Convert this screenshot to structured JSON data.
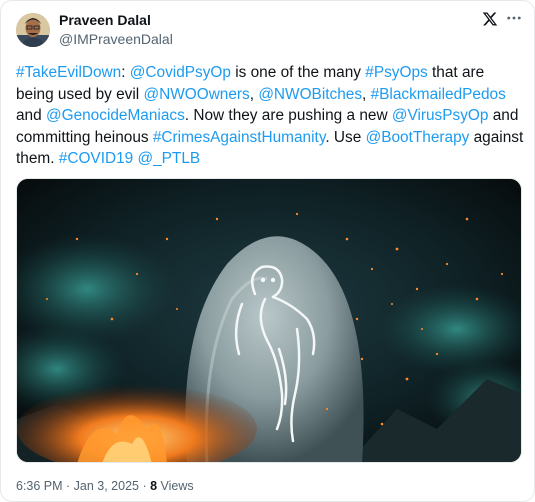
{
  "author": {
    "name": "Praveen Dalal",
    "handle": "@IMPraveenDalal"
  },
  "tweet": {
    "segments": [
      {
        "text": "#TakeEvilDown",
        "link": true
      },
      {
        "text": ": ",
        "link": false
      },
      {
        "text": "@CovidPsyOp",
        "link": true
      },
      {
        "text": " is one of the many ",
        "link": false
      },
      {
        "text": "#PsyOps",
        "link": true
      },
      {
        "text": " that are being used by evil ",
        "link": false
      },
      {
        "text": "@NWOOwners",
        "link": true
      },
      {
        "text": ", ",
        "link": false
      },
      {
        "text": "@NWOBitches",
        "link": true
      },
      {
        "text": ", ",
        "link": false
      },
      {
        "text": "#BlackmailedPedos",
        "link": true
      },
      {
        "text": " and ",
        "link": false
      },
      {
        "text": "@GenocideManiacs",
        "link": true
      },
      {
        "text": ". Now they are pushing a new ",
        "link": false
      },
      {
        "text": "@VirusPsyOp",
        "link": true
      },
      {
        "text": " and committing heinous ",
        "link": false
      },
      {
        "text": "#CrimesAgainstHumanity",
        "link": true
      },
      {
        "text": ". Use ",
        "link": false
      },
      {
        "text": "@BootTherapy",
        "link": true
      },
      {
        "text": " against them. ",
        "link": false
      },
      {
        "text": "#COVID19",
        "link": true
      },
      {
        "text": " ",
        "link": false
      },
      {
        "text": "@_PTLB",
        "link": true
      }
    ]
  },
  "meta": {
    "timestamp": "6:36 PM · Jan 3, 2025 · ",
    "views_count": "8",
    "views_label": " Views"
  },
  "icons": {
    "logo": "x-logo-icon",
    "more": "more-horizontal-icon"
  },
  "colors": {
    "link": "#1d9bf0",
    "text": "#0f1419",
    "secondary": "#536471"
  }
}
